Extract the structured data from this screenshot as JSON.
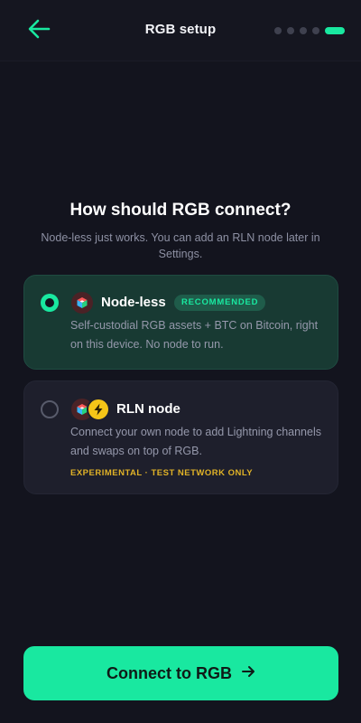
{
  "header": {
    "title": "RGB setup",
    "back_icon": "arrow-left-icon",
    "steps_total": 5,
    "step_current": 5
  },
  "prompt": {
    "title": "How should RGB connect?",
    "subtitle": "Node-less just works. You can add an RLN node later in Settings."
  },
  "options": [
    {
      "title": "Node-less",
      "badge": "RECOMMENDED",
      "description": "Self-custodial RGB assets + BTC on Bitcoin, right on this device. No node to run.",
      "selected": true,
      "icons": [
        "rgb-cube-icon"
      ]
    },
    {
      "title": "RLN node",
      "description": "Connect your own node to add Lightning channels and swaps on top of RGB.",
      "tag": "EXPERIMENTAL · TEST NETWORK ONLY",
      "selected": false,
      "icons": [
        "rgb-cube-icon",
        "lightning-bolt-icon"
      ]
    }
  ],
  "cta": {
    "label": "Connect to RGB",
    "icon": "arrow-right-icon"
  },
  "colors": {
    "accent": "#19e8a0",
    "background": "#13141e",
    "selected_card": "#183a33",
    "card": "#1e1f2c",
    "warning": "#e0b227"
  }
}
